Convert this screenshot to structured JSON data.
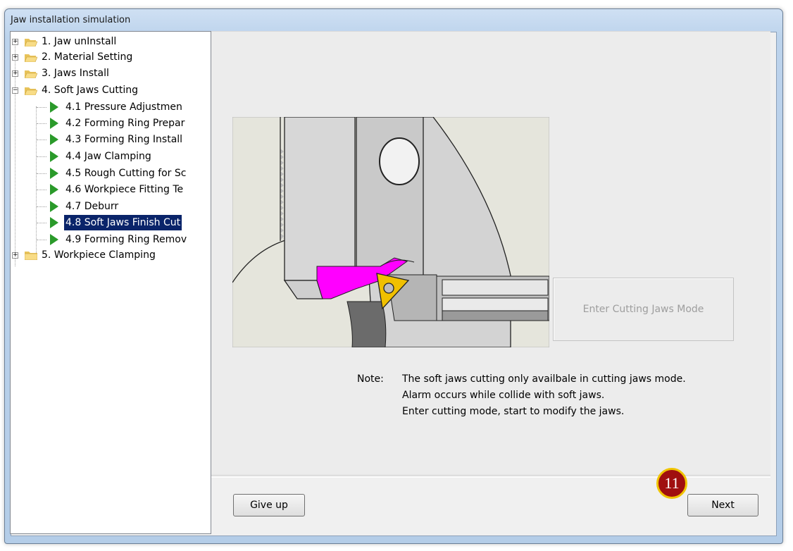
{
  "window": {
    "title": "Jaw installation simulation"
  },
  "tree": {
    "items": [
      {
        "label": "1. Jaw unInstall",
        "type": "folder",
        "expanded": false
      },
      {
        "label": "2. Material Setting",
        "type": "folder",
        "expanded": false
      },
      {
        "label": "3. Jaws Install",
        "type": "folder",
        "expanded": false
      },
      {
        "label": "4. Soft Jaws Cutting",
        "type": "folder",
        "expanded": true
      },
      {
        "label": "4.1 Pressure Adjustmen",
        "type": "step"
      },
      {
        "label": "4.2 Forming Ring Prepar",
        "type": "step"
      },
      {
        "label": "4.3 Forming Ring Install",
        "type": "step"
      },
      {
        "label": "4.4 Jaw Clamping",
        "type": "step"
      },
      {
        "label": "4.5 Rough Cutting for Sc",
        "type": "step"
      },
      {
        "label": "4.6 Workpiece Fitting Te",
        "type": "step"
      },
      {
        "label": "4.7 Deburr",
        "type": "step"
      },
      {
        "label": "4.8 Soft Jaws Finish Cut",
        "type": "step",
        "selected": true
      },
      {
        "label": "4.9 Forming Ring Remov",
        "type": "step"
      },
      {
        "label": "5. Workpiece Clamping",
        "type": "folder",
        "expanded": false
      }
    ]
  },
  "main": {
    "mode_button_label": "Enter Cutting Jaws Mode",
    "note": {
      "label": "Note:",
      "lines": [
        "The soft jaws cutting only availbale in cutting jaws mode.",
        "Alarm occurs while collide with soft jaws.",
        "Enter cutting mode, start to modify the jaws."
      ]
    }
  },
  "footer": {
    "give_up_label": "Give up",
    "next_label": "Next",
    "step_badge": "11"
  },
  "colors": {
    "selection": "#0a246a",
    "step_arrow": "#2a9a2a",
    "jaw_highlight": "#ff00ff",
    "insert": "#f0c000",
    "badge": "#a00f0f"
  }
}
